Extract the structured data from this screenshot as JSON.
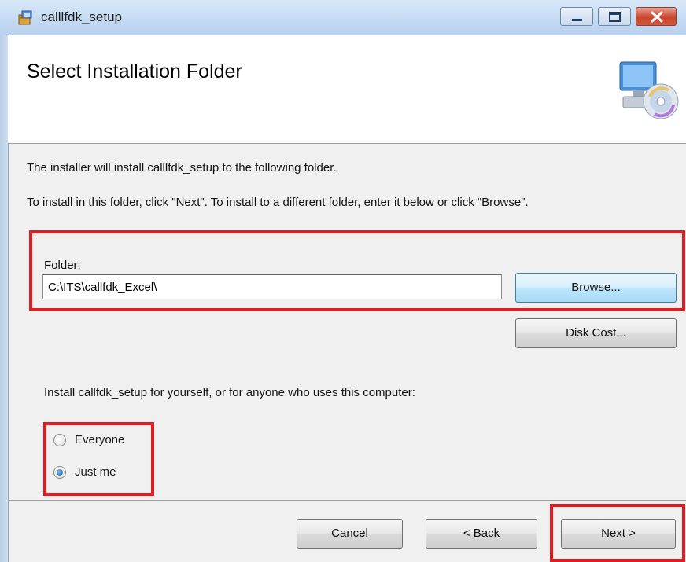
{
  "window": {
    "title": "calllfdk_setup",
    "title_icon": "installer-package-icon",
    "caption_buttons": [
      "minimize-icon",
      "maximize-icon",
      "close-icon"
    ],
    "close_color": "#c8442c"
  },
  "banner": {
    "title": "Select Installation Folder",
    "icon": "computer-disc-icon"
  },
  "body": {
    "line1": "The installer will install calllfdk_setup to the following folder.",
    "line2": "To install in this folder, click \"Next\". To install to a different folder, enter it below or click \"Browse\"."
  },
  "folder": {
    "label_accel": "F",
    "label_rest": "older:",
    "value": "C:\\ITS\\callfdk_Excel\\"
  },
  "buttons": {
    "browse": "Browse...",
    "disk_cost": "Disk Cost...",
    "cancel": "Cancel",
    "back": "< Back",
    "next": "Next >"
  },
  "install_for": {
    "prompt": "Install callfdk_setup for yourself, or for anyone who uses this computer:",
    "options": [
      {
        "label": "Everyone",
        "selected": false
      },
      {
        "label": "Just me",
        "selected": true
      }
    ]
  },
  "highlight_color": "#e01b24"
}
